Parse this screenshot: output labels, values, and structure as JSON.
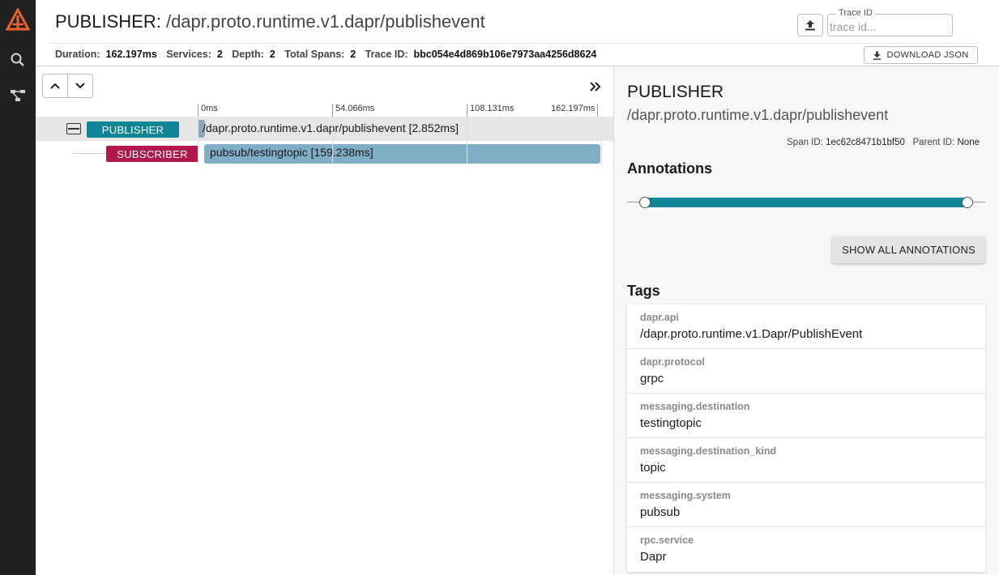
{
  "header": {
    "service": "PUBLISHER",
    "separator": ":",
    "operation": " /dapr.proto.runtime.v1.dapr/publishevent",
    "stats": {
      "duration_label": "Duration:",
      "duration_value": "162.197ms",
      "services_label": "Services:",
      "services_value": "2",
      "depth_label": "Depth:",
      "depth_value": "2",
      "total_spans_label": "Total Spans:",
      "total_spans_value": "2",
      "trace_id_label": "Trace ID:",
      "trace_id_value": "bbc054e4d869b106e7973aa4256d8624"
    },
    "trace_field_label": "Trace ID",
    "trace_field_placeholder": "trace id...",
    "download_label": "DOWNLOAD JSON"
  },
  "timeline": {
    "ticks": [
      "0ms",
      "54.066ms",
      "108.131ms",
      "162.197ms"
    ],
    "total_ms": 162.197,
    "spans": [
      {
        "service": "PUBLISHER",
        "label": "/dapr.proto.runtime.v1.dapr/publishevent [2.852ms]",
        "start_ms": 0,
        "duration_ms": 2.852,
        "color": "#0f8595",
        "bar_color": "#8aa9ba"
      },
      {
        "service": "SUBSCRIBER",
        "label": "pubsub/testingtopic [159.238ms]",
        "start_ms": 2.5,
        "duration_ms": 159.238,
        "color": "#b0184a",
        "bar_color": "#7faec6"
      }
    ]
  },
  "detail": {
    "service": "PUBLISHER",
    "operation": "/dapr.proto.runtime.v1.dapr/publishevent",
    "span_id_label": "Span ID:",
    "span_id": "1ec62c8471b1bf50",
    "parent_id_label": "Parent ID:",
    "parent_id": "None",
    "annotations_title": "Annotations",
    "show_all_label": "SHOW ALL ANNOTATIONS",
    "slider_range": [
      0.05,
      0.95
    ],
    "tags_title": "Tags",
    "tags": [
      {
        "key": "dapr.api",
        "value": "/dapr.proto.runtime.v1.Dapr/PublishEvent"
      },
      {
        "key": "dapr.protocol",
        "value": "grpc"
      },
      {
        "key": "messaging.destination",
        "value": "testingtopic"
      },
      {
        "key": "messaging.destination_kind",
        "value": "topic"
      },
      {
        "key": "messaging.system",
        "value": "pubsub"
      },
      {
        "key": "rpc.service",
        "value": "Dapr"
      }
    ]
  },
  "colors": {
    "accent": "#0f8595",
    "subscriber": "#b0184a",
    "sidebar": "#212121",
    "logo": "#e8622a"
  },
  "icons": [
    "logo-icon",
    "search-icon",
    "dependencies-icon",
    "upload-icon",
    "download-icon",
    "chevron-up-icon",
    "chevron-down-icon",
    "double-chevron-right-icon",
    "collapse-icon"
  ]
}
